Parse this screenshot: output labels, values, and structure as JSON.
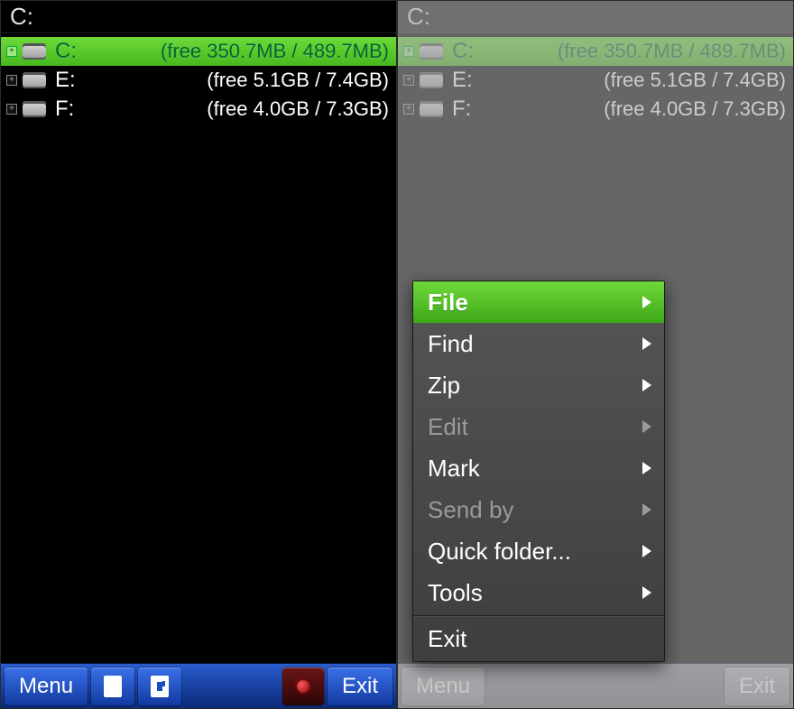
{
  "left": {
    "path": "C:",
    "drives": [
      {
        "label": "C:",
        "space": "(free 350.7MB / 489.7MB)",
        "selected": true
      },
      {
        "label": "E:",
        "space": "(free 5.1GB / 7.4GB)",
        "selected": false
      },
      {
        "label": "F:",
        "space": "(free 4.0GB / 7.3GB)",
        "selected": false
      }
    ],
    "toolbar": {
      "menu": "Menu",
      "exit": "Exit"
    }
  },
  "right": {
    "path": "C:",
    "drives": [
      {
        "label": "C:",
        "space": "(free 350.7MB / 489.7MB)",
        "selected": true
      },
      {
        "label": "E:",
        "space": "(free 5.1GB / 7.4GB)",
        "selected": false
      },
      {
        "label": "F:",
        "space": "(free 4.0GB / 7.3GB)",
        "selected": false
      }
    ],
    "toolbar": {
      "menu": "Menu",
      "exit": "Exit"
    }
  },
  "menu": {
    "items": [
      {
        "label": "File",
        "arrow": true,
        "state": "selected"
      },
      {
        "label": "Find",
        "arrow": true,
        "state": "normal"
      },
      {
        "label": "Zip",
        "arrow": true,
        "state": "normal"
      },
      {
        "label": "Edit",
        "arrow": true,
        "state": "disabled"
      },
      {
        "label": "Mark",
        "arrow": true,
        "state": "normal"
      },
      {
        "label": "Send by",
        "arrow": true,
        "state": "disabled"
      },
      {
        "label": "Quick folder...",
        "arrow": true,
        "state": "normal"
      },
      {
        "label": "Tools",
        "arrow": true,
        "state": "normal"
      }
    ],
    "exit": "Exit"
  }
}
